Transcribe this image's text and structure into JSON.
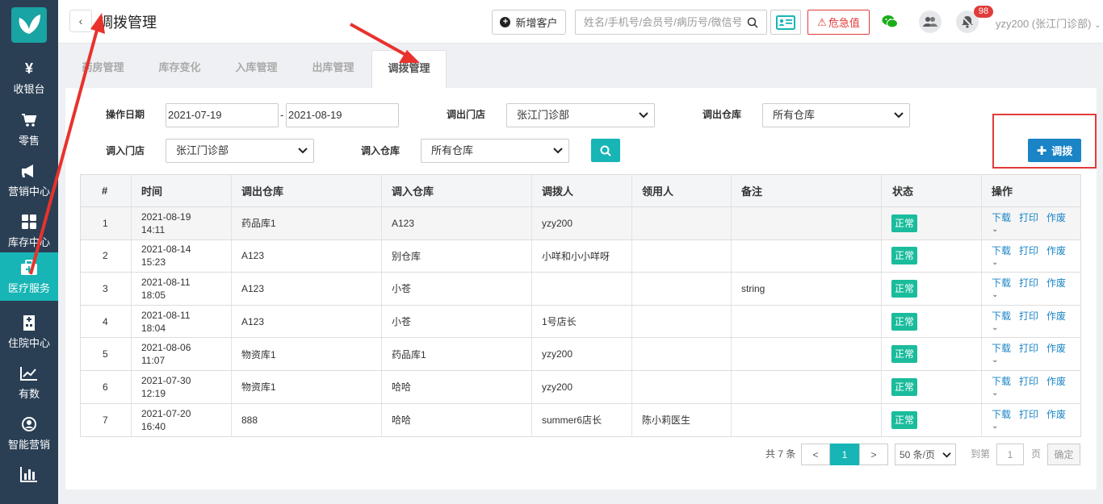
{
  "sidebar": {
    "items": [
      {
        "label": "收银台",
        "icon": "yen-icon"
      },
      {
        "label": "零售",
        "icon": "cart-icon"
      },
      {
        "label": "营销中心",
        "icon": "megaphone-icon"
      },
      {
        "label": "库存中心",
        "icon": "grid-icon"
      },
      {
        "label": "医疗服务",
        "icon": "medical-kit-icon",
        "active": true
      },
      {
        "label": "住院中心",
        "icon": "hospital-icon"
      },
      {
        "label": "有数",
        "icon": "trend-icon"
      },
      {
        "label": "智能营销",
        "icon": "robot-icon"
      },
      {
        "label": "",
        "icon": "bar-chart-icon"
      }
    ]
  },
  "header": {
    "title": "调拨管理",
    "new_customer": "新增客户",
    "search_placeholder": "姓名/手机号/会员号/病历号/微信号",
    "danger_label": "危急值",
    "notification_count": "98",
    "user": "yzy200 (张江门诊部)"
  },
  "tabs": [
    "药房管理",
    "库存变化",
    "入库管理",
    "出库管理",
    "调拨管理"
  ],
  "filters": {
    "date_label": "操作日期",
    "date_from": "2021-07-19",
    "date_sep": "-",
    "date_to": "2021-08-19",
    "out_store_label": "调出门店",
    "out_store_value": "张江门诊部",
    "out_warehouse_label": "调出仓库",
    "out_warehouse_value": "所有仓库",
    "in_store_label": "调入门店",
    "in_store_value": "张江门诊部",
    "in_warehouse_label": "调入仓库",
    "in_warehouse_value": "所有仓库",
    "transfer_button": "调拨"
  },
  "table": {
    "headers": [
      "#",
      "时间",
      "调出仓库",
      "调入仓库",
      "调拨人",
      "领用人",
      "备注",
      "状态",
      "操作"
    ],
    "rows": [
      {
        "no": "1",
        "date": "2021-08-19",
        "time": "14:11",
        "from": "药品库1",
        "to": "A123",
        "person": "yzy200",
        "receiver": "",
        "remark": "",
        "status": "正常"
      },
      {
        "no": "2",
        "date": "2021-08-14",
        "time": "15:23",
        "from": "A123",
        "to": "别仓库",
        "person": "小咩和小小咩呀",
        "receiver": "",
        "remark": "",
        "status": "正常"
      },
      {
        "no": "3",
        "date": "2021-08-11",
        "time": "18:05",
        "from": "A123",
        "to": "小苍",
        "person": "",
        "receiver": "",
        "remark": "string",
        "status": "正常"
      },
      {
        "no": "4",
        "date": "2021-08-11",
        "time": "18:04",
        "from": "A123",
        "to": "小苍",
        "person": "1号店长",
        "receiver": "",
        "remark": "",
        "status": "正常"
      },
      {
        "no": "5",
        "date": "2021-08-06",
        "time": "11:07",
        "from": "物资库1",
        "to": "药品库1",
        "person": "yzy200",
        "receiver": "",
        "remark": "",
        "status": "正常"
      },
      {
        "no": "6",
        "date": "2021-07-30",
        "time": "12:19",
        "from": "物资库1",
        "to": "哈哈",
        "person": "yzy200",
        "receiver": "",
        "remark": "",
        "status": "正常"
      },
      {
        "no": "7",
        "date": "2021-07-20",
        "time": "16:40",
        "from": "888",
        "to": "哈哈",
        "person": "summer6店长",
        "receiver": "陈小莉医生",
        "remark": "",
        "status": "正常"
      }
    ],
    "actions": {
      "download": "下载",
      "print": "打印",
      "void": "作废"
    }
  },
  "pagination": {
    "total": "共 7 条",
    "prev": "<",
    "current": "1",
    "next": ">",
    "page_size": "50 条/页",
    "goto_label": "到第",
    "goto_value": "1",
    "page_unit": "页",
    "confirm": "确定"
  },
  "colors": {
    "sidebar": "#2a3f54",
    "accent": "#17b5b5",
    "primary": "#1a84c6",
    "danger": "#e23b3b",
    "status": "#1abc9c"
  }
}
